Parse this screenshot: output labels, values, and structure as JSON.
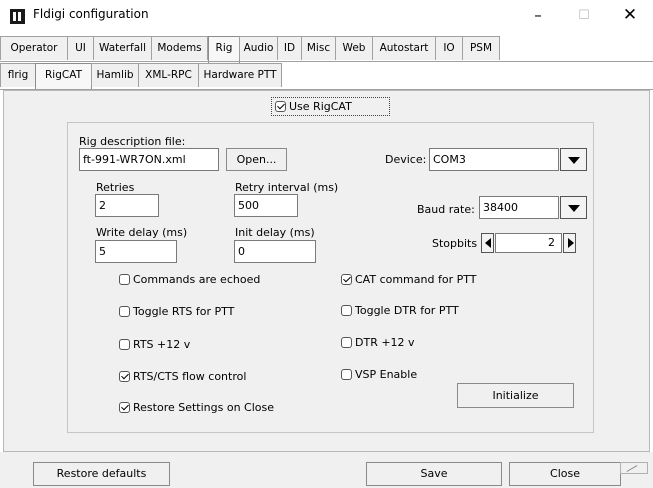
{
  "window": {
    "title": "Fldigi configuration",
    "minimize": "–",
    "maximize": "☐",
    "close": "✕",
    "icon": "fldigi-app-icon"
  },
  "main_tabs": [
    "Operator",
    "UI",
    "Waterfall",
    "Modems",
    "Rig",
    "Audio",
    "ID",
    "Misc",
    "Web",
    "Autostart",
    "IO",
    "PSM"
  ],
  "main_tab_active": "Rig",
  "sub_tabs": [
    "flrig",
    "RigCAT",
    "Hamlib",
    "XML-RPC",
    "Hardware PTT"
  ],
  "sub_tab_active": "RigCAT",
  "use_rigcat": {
    "label": "Use RigCAT",
    "checked": true
  },
  "rig_file": {
    "label": "Rig description file:",
    "value": "ft-991-WR7ON.xml",
    "open_button": "Open..."
  },
  "device": {
    "label": "Device:",
    "value": "COM3"
  },
  "retries": {
    "label": "Retries",
    "value": "2"
  },
  "retry_interval": {
    "label": "Retry interval (ms)",
    "value": "500"
  },
  "baud_rate": {
    "label": "Baud rate:",
    "value": "38400"
  },
  "write_delay": {
    "label": "Write delay (ms)",
    "value": "5"
  },
  "init_delay": {
    "label": "Init delay (ms)",
    "value": "0"
  },
  "stopbits": {
    "label": "Stopbits",
    "value": "2"
  },
  "checks": {
    "commands_echoed": {
      "label": "Commands are echoed",
      "checked": false
    },
    "cat_ptt": {
      "label": "CAT command for PTT",
      "checked": true
    },
    "rts_ptt": {
      "label": "Toggle RTS for PTT",
      "checked": false
    },
    "dtr_ptt": {
      "label": "Toggle DTR for PTT",
      "checked": false
    },
    "rts_12v": {
      "label": "RTS +12 v",
      "checked": false
    },
    "dtr_12v": {
      "label": "DTR +12 v",
      "checked": false
    },
    "rts_cts": {
      "label": "RTS/CTS flow control",
      "checked": true
    },
    "vsp": {
      "label": "VSP Enable",
      "checked": false
    },
    "restore_settings": {
      "label": "Restore Settings on Close",
      "checked": true
    }
  },
  "initialize_button": "Initialize",
  "footer": {
    "restore_defaults": "Restore defaults",
    "save": "Save",
    "close": "Close"
  }
}
